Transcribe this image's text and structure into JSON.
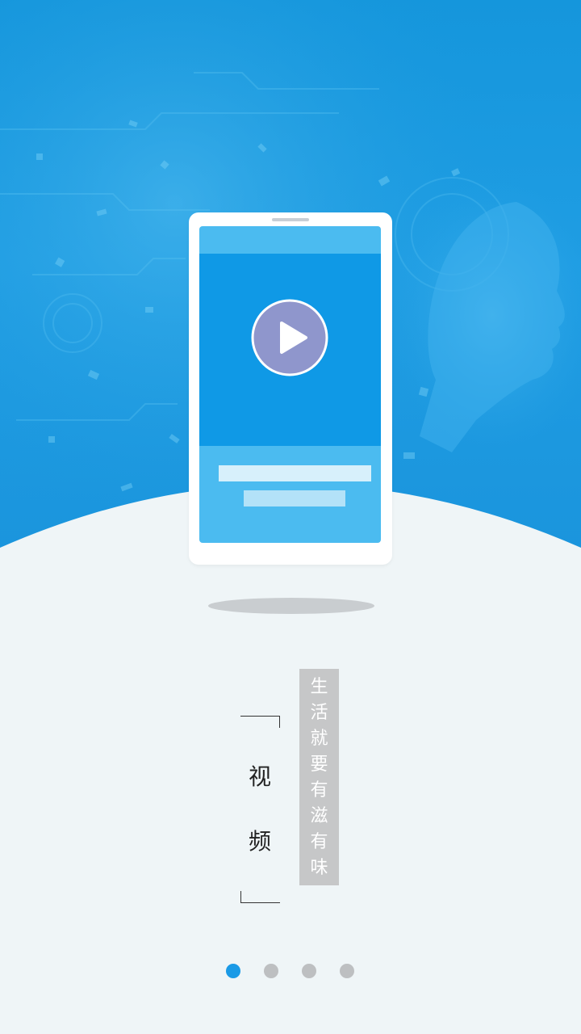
{
  "title": {
    "chars": [
      "视",
      "频"
    ]
  },
  "slogan": {
    "chars": [
      "生",
      "活",
      "就",
      "要",
      "有",
      "滋",
      "有",
      "味"
    ]
  },
  "pager": {
    "active_index": 0,
    "count": 4
  },
  "colors": {
    "hero_blue": "#1596dc",
    "screen_blue": "#0f99e6",
    "screen_light": "#4bbbf0",
    "play_circle": "#8f96cc",
    "dot_active": "#1a9ae6",
    "dot_inactive": "#bdbfc1",
    "slogan_bg": "#c6c7c8",
    "page_bg": "#eff5f7"
  },
  "icons": {
    "play": "play-icon"
  }
}
